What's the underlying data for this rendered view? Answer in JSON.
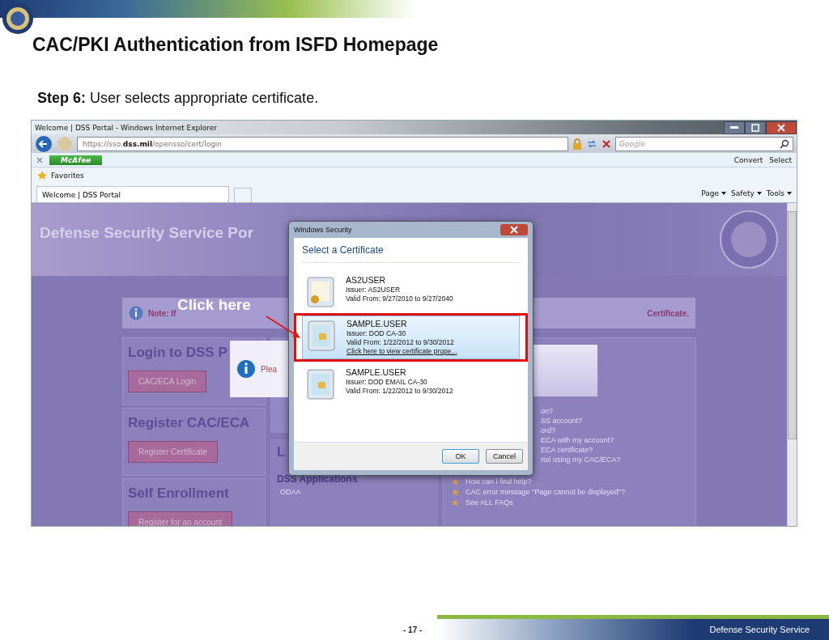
{
  "slide": {
    "title": "CAC/PKI Authentication from ISFD Homepage",
    "step_label": "Step 6:",
    "step_text": "User selects appropriate certificate."
  },
  "browser": {
    "window_title": "Welcome | DSS Portal - Windows Internet Explorer",
    "address": "https://sso.**dss.mil**/opensso/cert/login",
    "search_placeholder": "Google",
    "mcafee": "McAfee",
    "convert": "Convert",
    "select": "Select",
    "favorites": "Favorites",
    "tabs": [
      {
        "label": "Welcome | DSS Portal",
        "selected": true
      }
    ],
    "commands": [
      "Page",
      "Safety",
      "Tools"
    ]
  },
  "portal": {
    "header": "Defense Security Service Por",
    "note_start": "Note: If",
    "note_end": "Certificate.",
    "sections": [
      {
        "title": "Login to DSS P",
        "button": "CAC/ECA Login"
      },
      {
        "title": "Register CAC/ECA",
        "button": "Register Certificate"
      },
      {
        "title": "Self Enrollment",
        "button": "Register for an account"
      }
    ],
    "middle": {
      "heading": "L",
      "subheading": "DSS Applications",
      "links": [
        "ODAA"
      ]
    },
    "faq_fragments": [
      "on?",
      "SS account?",
      "ord?",
      "ECA with my account?",
      "ECA certificate?",
      "rtal using my CAC/ECA?"
    ],
    "faqs": [
      "How can I find help?",
      "CAC error message \"Page cannot be displayed\"?",
      "See ALL FAQs"
    ],
    "popup_text": "Plea"
  },
  "dialog": {
    "title": "Windows Security",
    "heading": "Select a Certificate",
    "certificates": [
      {
        "kind": "seal",
        "name": "AS2USER",
        "issuer": "Issuer: AS2USER",
        "valid": "Valid From: 9/27/2010 to 9/27/2040",
        "selected": false,
        "highlighted": false
      },
      {
        "kind": "card",
        "name": "SAMPLE.USER",
        "issuer": "Issuer: DOD CA-30",
        "valid": "Valid From: 1/22/2012 to 9/30/2012",
        "link": "Click here to view certificate prope...",
        "selected": true,
        "highlighted": true
      },
      {
        "kind": "card",
        "name": "SAMPLE.USER",
        "issuer": "Issuer: DOD EMAIL CA-30",
        "valid": "Valid From: 1/22/2012 to 9/30/2012",
        "selected": false,
        "highlighted": false
      }
    ],
    "buttons": [
      "OK",
      "Cancel"
    ]
  },
  "annotation": {
    "text": "Click here"
  },
  "footer": {
    "page": "- 17 -",
    "org": "Defense Security Service"
  }
}
